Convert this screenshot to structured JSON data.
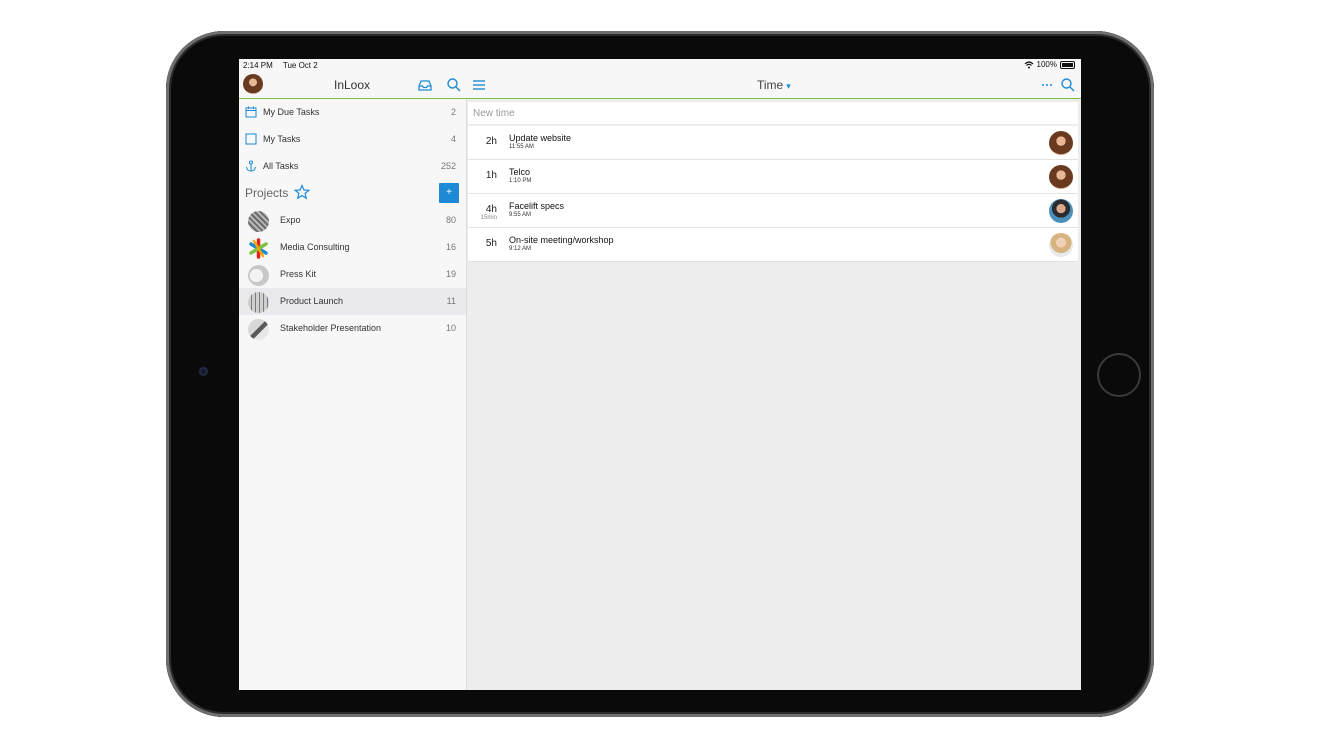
{
  "status_bar": {
    "time": "2:14 PM",
    "date": "Tue Oct 2",
    "battery": "100%"
  },
  "header": {
    "app_title": "InLoox",
    "main_title": "Time"
  },
  "icons": {
    "inbox": "inbox-icon",
    "search": "search-icon",
    "menu": "hamburger-icon",
    "more": "ellipsis-icon",
    "star": "star-icon",
    "calendar": "calendar-icon",
    "checkbox": "checkbox-icon",
    "all_tasks": "anchor-icon"
  },
  "colors": {
    "accent": "#1e8ad6",
    "header_rule": "#7dc242",
    "selected_row": "#e9e9ee"
  },
  "sidebar": {
    "nav": [
      {
        "label": "My Due Tasks",
        "count": "2"
      },
      {
        "label": "My Tasks",
        "count": "4"
      },
      {
        "label": "All Tasks",
        "count": "252"
      }
    ],
    "projects_label": "Projects",
    "add_label": "+",
    "projects": [
      {
        "label": "Expo",
        "count": "80"
      },
      {
        "label": "Media Consulting",
        "count": "16"
      },
      {
        "label": "Press Kit",
        "count": "19"
      },
      {
        "label": "Product Launch",
        "count": "11"
      },
      {
        "label": "Stakeholder Presentation",
        "count": "10"
      }
    ]
  },
  "main": {
    "new_time_placeholder": "New time",
    "entries": [
      {
        "duration": "2h",
        "extra": "",
        "title": "Update website",
        "time": "11:55 AM"
      },
      {
        "duration": "1h",
        "extra": "",
        "title": "Telco",
        "time": "1:10 PM"
      },
      {
        "duration": "4h",
        "extra": "15min",
        "title": "Facelift specs",
        "time": "9:55 AM"
      },
      {
        "duration": "5h",
        "extra": "",
        "title": "On-site meeting/workshop",
        "time": "9:12 AM"
      }
    ]
  }
}
